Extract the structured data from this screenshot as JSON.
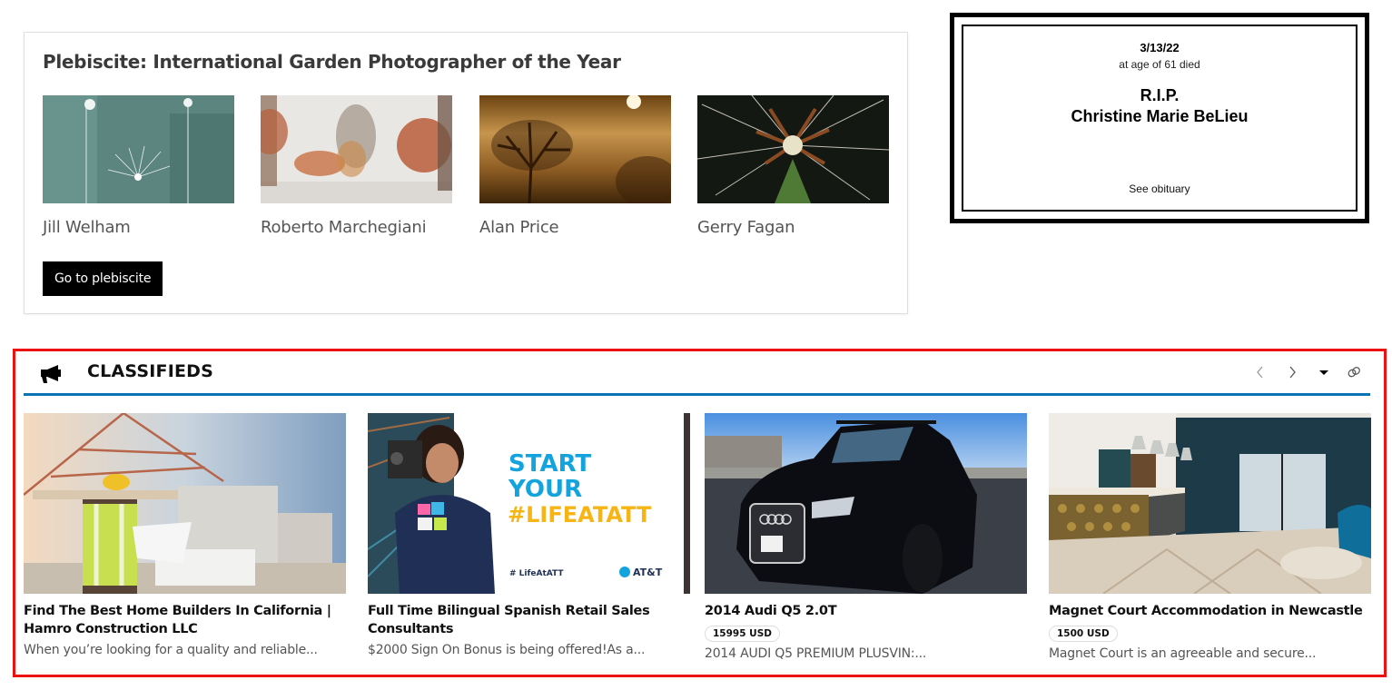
{
  "plebiscite": {
    "title": "Plebiscite: International Garden Photographer of the Year",
    "entries": [
      {
        "name": "Jill Welham",
        "image": "frosted-seedhead-photo"
      },
      {
        "name": "Roberto Marchegiani",
        "image": "misty-swamp-cypress-photo"
      },
      {
        "name": "Alan Price",
        "image": "sepia-tree-mist-photo"
      },
      {
        "name": "Gerry Fagan",
        "image": "dandelion-macro-photo"
      }
    ],
    "button_label": "Go to plebiscite"
  },
  "obituary": {
    "date": "3/13/22",
    "age_line": "at age of 61 died",
    "rip": "R.I.P.",
    "name": "Christine Marie BeLieu",
    "link_label": "See obituary"
  },
  "classifieds": {
    "title": "CLASSIFIEDS",
    "icons": {
      "header": "megaphone-icon",
      "prev": "chevron-left-icon",
      "next": "chevron-right-icon",
      "dropdown": "caret-down-icon",
      "link": "link-icon"
    },
    "colors": {
      "frame": "#ee1111",
      "rule": "#0a72b5"
    },
    "ads": [
      {
        "title": "Find The Best Home Builders In California | Hamro Construction LLC",
        "price": null,
        "description": "When you’re looking for a quality and reliable...",
        "image": "construction-worker-photo"
      },
      {
        "title": "Full Time Bilingual Spanish Retail Sales Consultants",
        "price": null,
        "description": "$2000 Sign On Bonus is being offered!As a...",
        "image": "att-recruiting-banner",
        "banner": {
          "line1": "START",
          "line2": "YOUR",
          "line3": "#LIFEATATT",
          "tag": "# LifeAtATT",
          "brand": "AT&T"
        }
      },
      {
        "title": "2014 Audi Q5 2.0T",
        "price": "15995 USD",
        "description": "2014 AUDI Q5 PREMIUM PLUSVIN:...",
        "image": "black-audi-suv-photo"
      },
      {
        "title": "Magnet Court Accommodation in Newcastle",
        "price": "1500 USD",
        "description": "Magnet Court is an agreeable and secure...",
        "image": "lobby-interior-photo"
      }
    ]
  }
}
